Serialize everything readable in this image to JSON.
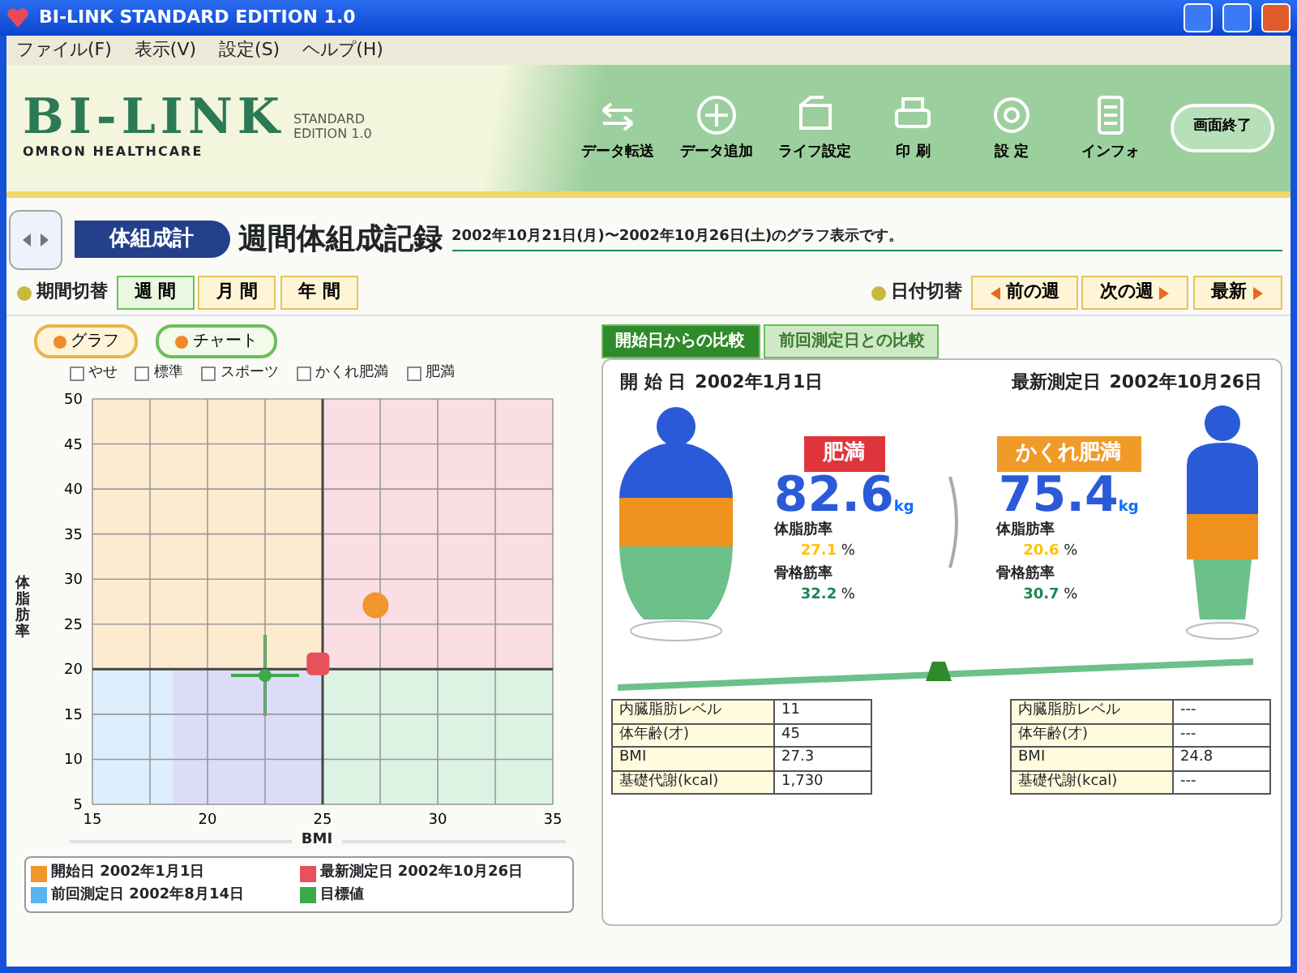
{
  "window": {
    "title": "BI-LINK STANDARD EDITION 1.0"
  },
  "menu": [
    "ファイル(F)",
    "表示(V)",
    "設定(S)",
    "ヘルプ(H)"
  ],
  "header": {
    "logo": "BI-LINK",
    "edition": [
      "STANDARD",
      "EDITION 1.0"
    ],
    "maker": "OMRON HEALTHCARE",
    "buttons": [
      "データ転送",
      "データ追加",
      "ライフ設定",
      "印 刷",
      "設 定",
      "インフォ"
    ],
    "exit_button": "画面終了"
  },
  "section_tab": "体組成計",
  "page_title": "週間体組成記録",
  "period_note": "2002年10月21日(月)〜2002年10月26日(土)のグラフ表示です。",
  "period": {
    "label": "期間切替",
    "options": [
      {
        "label": "週 間",
        "selected": true
      },
      {
        "label": "月 間",
        "selected": false
      },
      {
        "label": "年 間",
        "selected": false
      }
    ]
  },
  "date_nav": {
    "label": "日付切替",
    "buttons": [
      "前の週",
      "次の週",
      "最新"
    ]
  },
  "view_buttons": [
    {
      "label": "グラフ",
      "selected": true
    },
    {
      "label": "チャート",
      "selected": false
    }
  ],
  "chart": {
    "filters": [
      {
        "label": "やせ",
        "checked": false
      },
      {
        "label": "標準",
        "checked": false
      },
      {
        "label": "スポーツ",
        "checked": false
      },
      {
        "label": "かくれ肥満",
        "checked": false
      },
      {
        "label": "肥満",
        "checked": false
      }
    ],
    "chart_data": {
      "type": "scatter",
      "grid": true,
      "xlabel": "BMI",
      "ylabel": "体脂肪率",
      "x": [
        27.3,
        24.8,
        22.5
      ],
      "xlim": [
        15,
        35
      ],
      "ylim": [
        5,
        50
      ],
      "xticks": [
        15,
        20,
        25,
        30,
        35
      ],
      "yticks": [
        50,
        45,
        40,
        35,
        30,
        25,
        20,
        15,
        10,
        5
      ],
      "series": [
        {
          "name": "開始日 2002年1月1日",
          "color": "#f0962a",
          "values": [
            27.1,
            null,
            null
          ]
        },
        {
          "name": "最新測定日 2002年10月26日",
          "color": "#e8505a",
          "values": [
            null,
            20.6,
            null
          ]
        },
        {
          "name": "前回測定日 2002年8月14日",
          "color": "#5ab4f0",
          "values": [
            null,
            null,
            null
          ]
        },
        {
          "name": "目標値",
          "color": "#3aaa4a",
          "values": [
            null,
            null,
            19.3
          ]
        }
      ]
    }
  },
  "comparison": {
    "tabs": [
      {
        "label": "開始日からの比較",
        "selected": true
      },
      {
        "label": "前回測定日との比較",
        "selected": false
      }
    ],
    "records": [
      {
        "date_label": "開 始 日",
        "date": "2002年1月1日",
        "category": "肥満",
        "color": "#e0343c",
        "weight": "82.6",
        "unit": "kg",
        "fat_label": "体脂肪率",
        "fat": "27.1",
        "muscle_label": "骨格筋率",
        "muscle": "32.2",
        "pct": "%",
        "table": [
          {
            "label": "内臓脂肪レベル",
            "value": "11"
          },
          {
            "label": "体年齢(才)",
            "value": "45"
          },
          {
            "label": "BMI",
            "value": "27.3"
          },
          {
            "label": "基礎代謝(kcal)",
            "value": "1,730"
          }
        ]
      },
      {
        "date_label": "最新測定日",
        "date": "2002年10月26日",
        "category": "かくれ肥満",
        "color": "#f09a28",
        "weight": "75.4",
        "unit": "kg",
        "fat_label": "体脂肪率",
        "fat": "20.6",
        "muscle_label": "骨格筋率",
        "muscle": "30.7",
        "pct": "%",
        "table": [
          {
            "label": "内臓脂肪レベル",
            "value": "---"
          },
          {
            "label": "体年齢(才)",
            "value": "---"
          },
          {
            "label": "BMI",
            "value": "24.8"
          },
          {
            "label": "基礎代謝(kcal)",
            "value": "---"
          }
        ]
      }
    ]
  }
}
